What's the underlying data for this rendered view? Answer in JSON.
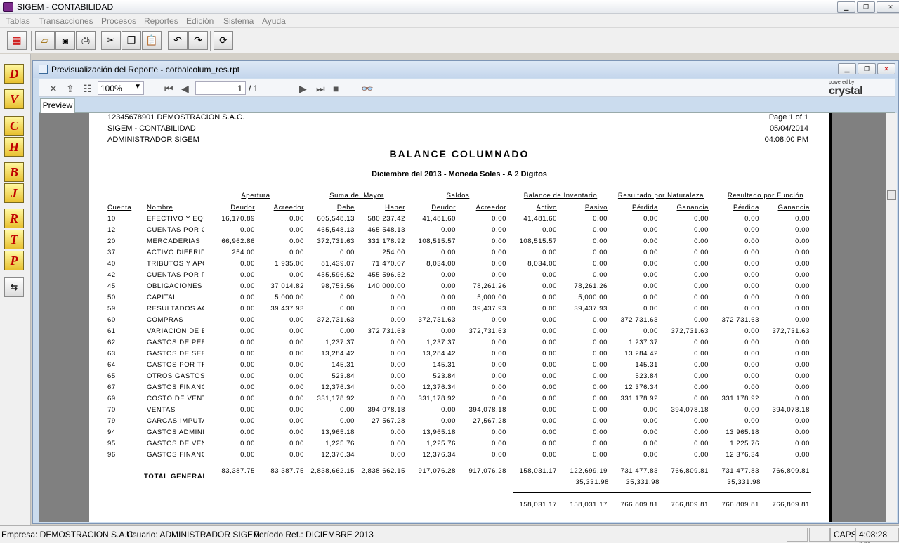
{
  "app": {
    "title": "SIGEM - CONTABILIDAD",
    "icon": "app-icon"
  },
  "menu": [
    "Tablas",
    "Transacciones",
    "Procesos",
    "Reportes",
    "Edición",
    "Sistema",
    "Ayuda"
  ],
  "toolbar": {
    "icons": [
      "exit-icon",
      "open-icon",
      "preview-icon",
      "print-icon",
      "cut-icon",
      "copy-icon",
      "paste-icon",
      "undo-icon",
      "redo-icon",
      "refresh-icon"
    ]
  },
  "left_toolbar": {
    "letters": [
      "D",
      "V",
      "C",
      "H",
      "B",
      "J",
      "R",
      "T",
      "P"
    ],
    "last_icon": "window-switch-icon"
  },
  "child": {
    "title": "Previsualización del Reporte - corbalcolum_res.rpt"
  },
  "viewer": {
    "zoom": "100%",
    "page": "1",
    "page_of": "/ 1",
    "powered": "powered by",
    "brand": "crystal",
    "tab": "Preview"
  },
  "report": {
    "company": "12345678901 DEMOSTRACION S.A.C.",
    "system": "SIGEM - CONTABILIDAD",
    "user": "ADMINISTRADOR SIGEM",
    "page": "Page 1 of 1",
    "date": "05/04/2014",
    "time": "04:08:00 PM",
    "title": "BALANCE COLUMNADO",
    "subtitle": "Diciembre del 2013 - Moneda Soles - A 2 Dígitos",
    "groups": [
      "Apertura",
      "Suma del Mayor",
      "Saldos",
      "Balance de Inventario",
      "Resultado por Naturaleza",
      "Resultado por Función"
    ],
    "col_cuenta": "Cuenta",
    "col_nombre": "Nombre",
    "columns": [
      "Deudor",
      "Acreedor",
      "Debe",
      "Haber",
      "Deudor",
      "Acreedor",
      "Activo",
      "Pasivo",
      "Pérdida",
      "Ganancia",
      "Pérdida",
      "Ganancia"
    ],
    "rows": [
      {
        "c": "10",
        "n": "EFECTIVO Y EQU",
        "v": [
          "16,170.89",
          "0.00",
          "605,548.13",
          "580,237.42",
          "41,481.60",
          "0.00",
          "41,481.60",
          "0.00",
          "0.00",
          "0.00",
          "0.00",
          "0.00"
        ]
      },
      {
        "c": "12",
        "n": "CUENTAS POR C",
        "v": [
          "0.00",
          "0.00",
          "465,548.13",
          "465,548.13",
          "0.00",
          "0.00",
          "0.00",
          "0.00",
          "0.00",
          "0.00",
          "0.00",
          "0.00"
        ]
      },
      {
        "c": "20",
        "n": "MERCADERIAS",
        "v": [
          "66,962.86",
          "0.00",
          "372,731.63",
          "331,178.92",
          "108,515.57",
          "0.00",
          "108,515.57",
          "0.00",
          "0.00",
          "0.00",
          "0.00",
          "0.00"
        ]
      },
      {
        "c": "37",
        "n": "ACTIVO DIFERIDO",
        "v": [
          "254.00",
          "0.00",
          "0.00",
          "254.00",
          "0.00",
          "0.00",
          "0.00",
          "0.00",
          "0.00",
          "0.00",
          "0.00",
          "0.00"
        ]
      },
      {
        "c": "40",
        "n": "TRIBUTOS Y APO",
        "v": [
          "0.00",
          "1,935.00",
          "81,439.07",
          "71,470.07",
          "8,034.00",
          "0.00",
          "8,034.00",
          "0.00",
          "0.00",
          "0.00",
          "0.00",
          "0.00"
        ]
      },
      {
        "c": "42",
        "n": "CUENTAS POR P",
        "v": [
          "0.00",
          "0.00",
          "455,596.52",
          "455,596.52",
          "0.00",
          "0.00",
          "0.00",
          "0.00",
          "0.00",
          "0.00",
          "0.00",
          "0.00"
        ]
      },
      {
        "c": "45",
        "n": "OBLIGACIONES F",
        "v": [
          "0.00",
          "37,014.82",
          "98,753.56",
          "140,000.00",
          "0.00",
          "78,261.26",
          "0.00",
          "78,261.26",
          "0.00",
          "0.00",
          "0.00",
          "0.00"
        ]
      },
      {
        "c": "50",
        "n": "CAPITAL",
        "v": [
          "0.00",
          "5,000.00",
          "0.00",
          "0.00",
          "0.00",
          "5,000.00",
          "0.00",
          "5,000.00",
          "0.00",
          "0.00",
          "0.00",
          "0.00"
        ]
      },
      {
        "c": "59",
        "n": "RESULTADOS AC",
        "v": [
          "0.00",
          "39,437.93",
          "0.00",
          "0.00",
          "0.00",
          "39,437.93",
          "0.00",
          "39,437.93",
          "0.00",
          "0.00",
          "0.00",
          "0.00"
        ]
      },
      {
        "c": "60",
        "n": "COMPRAS",
        "v": [
          "0.00",
          "0.00",
          "372,731.63",
          "0.00",
          "372,731.63",
          "0.00",
          "0.00",
          "0.00",
          "372,731.63",
          "0.00",
          "372,731.63",
          "0.00"
        ]
      },
      {
        "c": "61",
        "n": "VARIACION DE E",
        "v": [
          "0.00",
          "0.00",
          "0.00",
          "372,731.63",
          "0.00",
          "372,731.63",
          "0.00",
          "0.00",
          "0.00",
          "372,731.63",
          "0.00",
          "372,731.63"
        ]
      },
      {
        "c": "62",
        "n": "GASTOS DE PER",
        "v": [
          "0.00",
          "0.00",
          "1,237.37",
          "0.00",
          "1,237.37",
          "0.00",
          "0.00",
          "0.00",
          "1,237.37",
          "0.00",
          "0.00",
          "0.00"
        ]
      },
      {
        "c": "63",
        "n": "GASTOS DE SER",
        "v": [
          "0.00",
          "0.00",
          "13,284.42",
          "0.00",
          "13,284.42",
          "0.00",
          "0.00",
          "0.00",
          "13,284.42",
          "0.00",
          "0.00",
          "0.00"
        ]
      },
      {
        "c": "64",
        "n": "GASTOS POR TR",
        "v": [
          "0.00",
          "0.00",
          "145.31",
          "0.00",
          "145.31",
          "0.00",
          "0.00",
          "0.00",
          "145.31",
          "0.00",
          "0.00",
          "0.00"
        ]
      },
      {
        "c": "65",
        "n": "OTROS GASTOS",
        "v": [
          "0.00",
          "0.00",
          "523.84",
          "0.00",
          "523.84",
          "0.00",
          "0.00",
          "0.00",
          "523.84",
          "0.00",
          "0.00",
          "0.00"
        ]
      },
      {
        "c": "67",
        "n": "GASTOS FINANC",
        "v": [
          "0.00",
          "0.00",
          "12,376.34",
          "0.00",
          "12,376.34",
          "0.00",
          "0.00",
          "0.00",
          "12,376.34",
          "0.00",
          "0.00",
          "0.00"
        ]
      },
      {
        "c": "69",
        "n": "COSTO DE VENT",
        "v": [
          "0.00",
          "0.00",
          "331,178.92",
          "0.00",
          "331,178.92",
          "0.00",
          "0.00",
          "0.00",
          "331,178.92",
          "0.00",
          "331,178.92",
          "0.00"
        ]
      },
      {
        "c": "70",
        "n": "VENTAS",
        "v": [
          "0.00",
          "0.00",
          "0.00",
          "394,078.18",
          "0.00",
          "394,078.18",
          "0.00",
          "0.00",
          "0.00",
          "394,078.18",
          "0.00",
          "394,078.18"
        ]
      },
      {
        "c": "79",
        "n": "CARGAS IMPUTA",
        "v": [
          "0.00",
          "0.00",
          "0.00",
          "27,567.28",
          "0.00",
          "27,567.28",
          "0.00",
          "0.00",
          "0.00",
          "0.00",
          "0.00",
          "0.00"
        ]
      },
      {
        "c": "94",
        "n": "GASTOS ADMINIS",
        "v": [
          "0.00",
          "0.00",
          "13,965.18",
          "0.00",
          "13,965.18",
          "0.00",
          "0.00",
          "0.00",
          "0.00",
          "0.00",
          "13,965.18",
          "0.00"
        ]
      },
      {
        "c": "95",
        "n": "GASTOS DE VEN",
        "v": [
          "0.00",
          "0.00",
          "1,225.76",
          "0.00",
          "1,225.76",
          "0.00",
          "0.00",
          "0.00",
          "0.00",
          "0.00",
          "1,225.76",
          "0.00"
        ]
      },
      {
        "c": "96",
        "n": "GASTOS FINANC",
        "v": [
          "0.00",
          "0.00",
          "12,376.34",
          "0.00",
          "12,376.34",
          "0.00",
          "0.00",
          "0.00",
          "0.00",
          "0.00",
          "12,376.34",
          "0.00"
        ]
      }
    ],
    "total_label": "TOTAL GENERAL",
    "totals": [
      "83,387.75",
      "83,387.75",
      "2,838,662.15",
      "2,838,662.15",
      "917,076.28",
      "917,076.28",
      "158,031.17",
      "122,699.19",
      "731,477.83",
      "766,809.81",
      "731,477.83",
      "766,809.81"
    ],
    "diff": {
      "pasivo": "35,331.98",
      "perdida_nat": "35,331.98",
      "perdida_fun": "35,331.98"
    },
    "final": [
      "158,031.17",
      "158,031.17",
      "766,809.81",
      "766,809.81",
      "766,809.81",
      "766,809.81"
    ]
  },
  "status": {
    "empresa": "Empresa: DEMOSTRACION S.A.C.",
    "usuario": "Usuario: ADMINISTRADOR SIGEM",
    "periodo": "Período Ref.: DICIEMBRE 2013",
    "caps": "CAPS",
    "time": "4:08:28 pm"
  }
}
